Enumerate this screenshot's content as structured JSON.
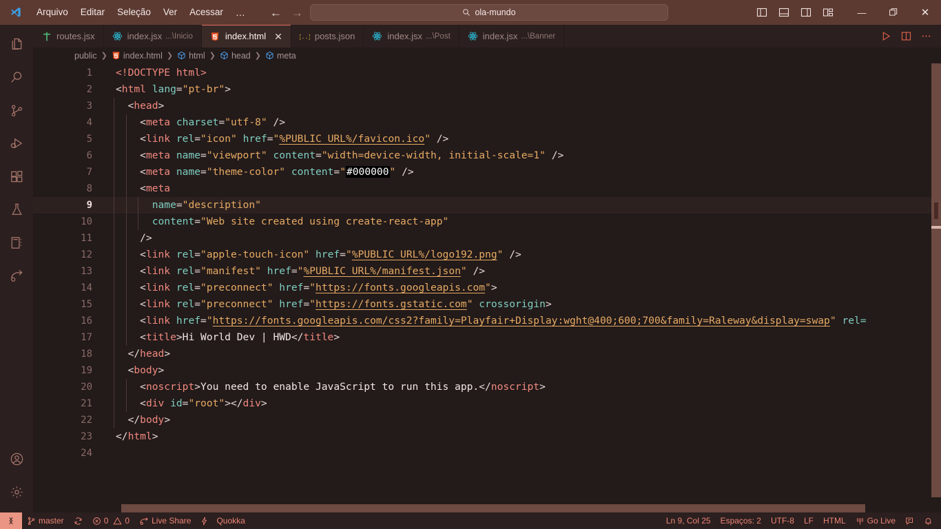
{
  "titlebar": {
    "logo_icon": "vscode-logo-icon",
    "menu": [
      "Arquivo",
      "Editar",
      "Seleção",
      "Ver",
      "Acessar",
      "…"
    ],
    "nav": {
      "back_icon": "arrow-left-icon",
      "forward_icon": "arrow-right-icon"
    },
    "search": {
      "icon": "search-icon",
      "value": "ola-mundo",
      "placeholder": "Pesquisar"
    },
    "layout_icons": [
      "toggle-primary-sidebar-icon",
      "toggle-panel-icon",
      "toggle-secondary-sidebar-icon",
      "customize-layout-icon"
    ],
    "window_controls": {
      "minimize": "—",
      "maximize": "❐",
      "close": "✕"
    }
  },
  "activitybar": {
    "items": [
      {
        "name": "explorer-icon",
        "label": "Explorador"
      },
      {
        "name": "search-icon",
        "label": "Pesquisar"
      },
      {
        "name": "source-control-icon",
        "label": "Controle do Código-Fonte"
      },
      {
        "name": "run-and-debug-icon",
        "label": "Executar e Depurar"
      },
      {
        "name": "extensions-icon",
        "label": "Extensões"
      },
      {
        "name": "testing-flask-icon",
        "label": "Teste"
      },
      {
        "name": "notebook-icon",
        "label": "Bloco de Anotações"
      },
      {
        "name": "live-share-icon",
        "label": "Live Share"
      }
    ],
    "bottom": [
      {
        "name": "account-icon",
        "label": "Contas"
      },
      {
        "name": "settings-gear-icon",
        "label": "Gerenciar"
      }
    ]
  },
  "tabs": [
    {
      "label": "routes.jsx",
      "sub": "",
      "icon": "react-router-icon",
      "active": false,
      "dirty": false
    },
    {
      "label": "index.jsx",
      "sub": "...\\Inicio",
      "icon": "react-icon",
      "active": false,
      "dirty": false
    },
    {
      "label": "index.html",
      "sub": "",
      "icon": "html5-icon",
      "active": true,
      "dirty": false,
      "close": "✕"
    },
    {
      "label": "posts.json",
      "sub": "",
      "icon": "json-icon",
      "active": false,
      "dirty": false
    },
    {
      "label": "index.jsx",
      "sub": "...\\Post",
      "icon": "react-icon",
      "active": false,
      "dirty": false
    },
    {
      "label": "index.jsx",
      "sub": "...\\Banner",
      "icon": "react-icon",
      "active": false,
      "dirty": false
    }
  ],
  "tab_actions": [
    {
      "name": "run-code-icon",
      "label": "Executar Código"
    },
    {
      "name": "split-editor-right-icon",
      "label": "Dividir Editor à Direita"
    },
    {
      "name": "more-actions-icon",
      "label": "Mais Ações..."
    }
  ],
  "breadcrumbs": [
    {
      "label": "public",
      "icon": ""
    },
    {
      "label": "index.html",
      "icon": "html5-icon"
    },
    {
      "label": "html",
      "icon": "symbol-field-icon"
    },
    {
      "label": "head",
      "icon": "symbol-field-icon"
    },
    {
      "label": "meta",
      "icon": "symbol-field-icon"
    }
  ],
  "editor": {
    "language": "HTML",
    "active_line": 9,
    "total_lines": 24,
    "lines": [
      {
        "n": 1,
        "indent": 0,
        "tokens": [
          {
            "c": "t-doctype",
            "t": "<!DOCTYPE html>"
          }
        ]
      },
      {
        "n": 2,
        "indent": 0,
        "tokens": [
          {
            "c": "t-punc",
            "t": "<"
          },
          {
            "c": "t-tag",
            "t": "html"
          },
          {
            "c": "t-punc",
            "t": " "
          },
          {
            "c": "t-attr",
            "t": "lang"
          },
          {
            "c": "t-punc",
            "t": "="
          },
          {
            "c": "t-str",
            "t": "\"pt-br\""
          },
          {
            "c": "t-punc",
            "t": ">"
          }
        ]
      },
      {
        "n": 3,
        "indent": 1,
        "tokens": [
          {
            "c": "t-punc",
            "t": "  <"
          },
          {
            "c": "t-tag",
            "t": "head"
          },
          {
            "c": "t-punc",
            "t": ">"
          }
        ]
      },
      {
        "n": 4,
        "indent": 2,
        "tokens": [
          {
            "c": "t-punc",
            "t": "    <"
          },
          {
            "c": "t-tag",
            "t": "meta"
          },
          {
            "c": "t-punc",
            "t": " "
          },
          {
            "c": "t-attr",
            "t": "charset"
          },
          {
            "c": "t-punc",
            "t": "="
          },
          {
            "c": "t-str",
            "t": "\"utf-8\""
          },
          {
            "c": "t-punc",
            "t": " />"
          }
        ]
      },
      {
        "n": 5,
        "indent": 2,
        "tokens": [
          {
            "c": "t-punc",
            "t": "    <"
          },
          {
            "c": "t-tag",
            "t": "link"
          },
          {
            "c": "t-punc",
            "t": " "
          },
          {
            "c": "t-attr",
            "t": "rel"
          },
          {
            "c": "t-punc",
            "t": "="
          },
          {
            "c": "t-str",
            "t": "\"icon\""
          },
          {
            "c": "t-punc",
            "t": " "
          },
          {
            "c": "t-attr",
            "t": "href"
          },
          {
            "c": "t-punc",
            "t": "="
          },
          {
            "c": "t-str",
            "t": "\""
          },
          {
            "c": "t-link",
            "t": "%PUBLIC_URL%/favicon.ico"
          },
          {
            "c": "t-str",
            "t": "\""
          },
          {
            "c": "t-punc",
            "t": " />"
          }
        ]
      },
      {
        "n": 6,
        "indent": 2,
        "tokens": [
          {
            "c": "t-punc",
            "t": "    <"
          },
          {
            "c": "t-tag",
            "t": "meta"
          },
          {
            "c": "t-punc",
            "t": " "
          },
          {
            "c": "t-attr",
            "t": "name"
          },
          {
            "c": "t-punc",
            "t": "="
          },
          {
            "c": "t-str",
            "t": "\"viewport\""
          },
          {
            "c": "t-punc",
            "t": " "
          },
          {
            "c": "t-attr",
            "t": "content"
          },
          {
            "c": "t-punc",
            "t": "="
          },
          {
            "c": "t-str",
            "t": "\"width=device-width, initial-scale=1\""
          },
          {
            "c": "t-punc",
            "t": " />"
          }
        ]
      },
      {
        "n": 7,
        "indent": 2,
        "tokens": [
          {
            "c": "t-punc",
            "t": "    <"
          },
          {
            "c": "t-tag",
            "t": "meta"
          },
          {
            "c": "t-punc",
            "t": " "
          },
          {
            "c": "t-attr",
            "t": "name"
          },
          {
            "c": "t-punc",
            "t": "="
          },
          {
            "c": "t-str",
            "t": "\"theme-color\""
          },
          {
            "c": "t-punc",
            "t": " "
          },
          {
            "c": "t-attr",
            "t": "content"
          },
          {
            "c": "t-punc",
            "t": "="
          },
          {
            "c": "t-str",
            "t": "\""
          },
          {
            "c": "swatch",
            "t": "#000000"
          },
          {
            "c": "t-str",
            "t": "\""
          },
          {
            "c": "t-punc",
            "t": " />"
          }
        ]
      },
      {
        "n": 8,
        "indent": 2,
        "tokens": [
          {
            "c": "t-punc",
            "t": "    <"
          },
          {
            "c": "t-tag",
            "t": "meta"
          }
        ]
      },
      {
        "n": 9,
        "indent": 3,
        "tokens": [
          {
            "c": "t-punc",
            "t": "      "
          },
          {
            "c": "t-attr",
            "t": "name"
          },
          {
            "c": "t-punc",
            "t": "="
          },
          {
            "c": "t-str",
            "t": "\"description\""
          }
        ]
      },
      {
        "n": 10,
        "indent": 3,
        "tokens": [
          {
            "c": "t-punc",
            "t": "      "
          },
          {
            "c": "t-attr",
            "t": "content"
          },
          {
            "c": "t-punc",
            "t": "="
          },
          {
            "c": "t-str",
            "t": "\"Web site created using create-react-app\""
          }
        ]
      },
      {
        "n": 11,
        "indent": 2,
        "tokens": [
          {
            "c": "t-punc",
            "t": "    />"
          }
        ]
      },
      {
        "n": 12,
        "indent": 2,
        "tokens": [
          {
            "c": "t-punc",
            "t": "    <"
          },
          {
            "c": "t-tag",
            "t": "link"
          },
          {
            "c": "t-punc",
            "t": " "
          },
          {
            "c": "t-attr",
            "t": "rel"
          },
          {
            "c": "t-punc",
            "t": "="
          },
          {
            "c": "t-str",
            "t": "\"apple-touch-icon\""
          },
          {
            "c": "t-punc",
            "t": " "
          },
          {
            "c": "t-attr",
            "t": "href"
          },
          {
            "c": "t-punc",
            "t": "="
          },
          {
            "c": "t-str",
            "t": "\""
          },
          {
            "c": "t-link",
            "t": "%PUBLIC_URL%/logo192.png"
          },
          {
            "c": "t-str",
            "t": "\""
          },
          {
            "c": "t-punc",
            "t": " />"
          }
        ]
      },
      {
        "n": 13,
        "indent": 2,
        "tokens": [
          {
            "c": "t-punc",
            "t": "    <"
          },
          {
            "c": "t-tag",
            "t": "link"
          },
          {
            "c": "t-punc",
            "t": " "
          },
          {
            "c": "t-attr",
            "t": "rel"
          },
          {
            "c": "t-punc",
            "t": "="
          },
          {
            "c": "t-str",
            "t": "\"manifest\""
          },
          {
            "c": "t-punc",
            "t": " "
          },
          {
            "c": "t-attr",
            "t": "href"
          },
          {
            "c": "t-punc",
            "t": "="
          },
          {
            "c": "t-str",
            "t": "\""
          },
          {
            "c": "t-link",
            "t": "%PUBLIC_URL%/manifest.json"
          },
          {
            "c": "t-str",
            "t": "\""
          },
          {
            "c": "t-punc",
            "t": " />"
          }
        ]
      },
      {
        "n": 14,
        "indent": 2,
        "tokens": [
          {
            "c": "t-punc",
            "t": "    <"
          },
          {
            "c": "t-tag",
            "t": "link"
          },
          {
            "c": "t-punc",
            "t": " "
          },
          {
            "c": "t-attr",
            "t": "rel"
          },
          {
            "c": "t-punc",
            "t": "="
          },
          {
            "c": "t-str",
            "t": "\"preconnect\""
          },
          {
            "c": "t-punc",
            "t": " "
          },
          {
            "c": "t-attr",
            "t": "href"
          },
          {
            "c": "t-punc",
            "t": "="
          },
          {
            "c": "t-str",
            "t": "\""
          },
          {
            "c": "t-link",
            "t": "https://fonts.googleapis.com"
          },
          {
            "c": "t-str",
            "t": "\""
          },
          {
            "c": "t-punc",
            "t": ">"
          }
        ]
      },
      {
        "n": 15,
        "indent": 2,
        "tokens": [
          {
            "c": "t-punc",
            "t": "    <"
          },
          {
            "c": "t-tag",
            "t": "link"
          },
          {
            "c": "t-punc",
            "t": " "
          },
          {
            "c": "t-attr",
            "t": "rel"
          },
          {
            "c": "t-punc",
            "t": "="
          },
          {
            "c": "t-str",
            "t": "\"preconnect\""
          },
          {
            "c": "t-punc",
            "t": " "
          },
          {
            "c": "t-attr",
            "t": "href"
          },
          {
            "c": "t-punc",
            "t": "="
          },
          {
            "c": "t-str",
            "t": "\""
          },
          {
            "c": "t-link",
            "t": "https://fonts.gstatic.com"
          },
          {
            "c": "t-str",
            "t": "\""
          },
          {
            "c": "t-punc",
            "t": " "
          },
          {
            "c": "t-attr",
            "t": "crossorigin"
          },
          {
            "c": "t-punc",
            "t": ">"
          }
        ]
      },
      {
        "n": 16,
        "indent": 2,
        "tokens": [
          {
            "c": "t-punc",
            "t": "    <"
          },
          {
            "c": "t-tag",
            "t": "link"
          },
          {
            "c": "t-punc",
            "t": " "
          },
          {
            "c": "t-attr",
            "t": "href"
          },
          {
            "c": "t-punc",
            "t": "="
          },
          {
            "c": "t-str",
            "t": "\""
          },
          {
            "c": "t-link",
            "t": "https://fonts.googleapis.com/css2?family=Playfair+Display:wght@400;600;700&family=Raleway&display=swap"
          },
          {
            "c": "t-str",
            "t": "\""
          },
          {
            "c": "t-punc",
            "t": " "
          },
          {
            "c": "t-attr",
            "t": "rel="
          }
        ]
      },
      {
        "n": 17,
        "indent": 2,
        "tokens": [
          {
            "c": "t-punc",
            "t": "    <"
          },
          {
            "c": "t-tag",
            "t": "title"
          },
          {
            "c": "t-punc",
            "t": ">"
          },
          {
            "c": "t-txt",
            "t": "Hi World Dev | HWD"
          },
          {
            "c": "t-punc",
            "t": "</"
          },
          {
            "c": "t-tag",
            "t": "title"
          },
          {
            "c": "t-punc",
            "t": ">"
          }
        ]
      },
      {
        "n": 18,
        "indent": 1,
        "tokens": [
          {
            "c": "t-punc",
            "t": "  </"
          },
          {
            "c": "t-tag",
            "t": "head"
          },
          {
            "c": "t-punc",
            "t": ">"
          }
        ]
      },
      {
        "n": 19,
        "indent": 1,
        "tokens": [
          {
            "c": "t-punc",
            "t": "  <"
          },
          {
            "c": "t-tag",
            "t": "body"
          },
          {
            "c": "t-punc",
            "t": ">"
          }
        ]
      },
      {
        "n": 20,
        "indent": 2,
        "tokens": [
          {
            "c": "t-punc",
            "t": "    <"
          },
          {
            "c": "t-tag",
            "t": "noscript"
          },
          {
            "c": "t-punc",
            "t": ">"
          },
          {
            "c": "t-txt",
            "t": "You need to enable JavaScript to run this app."
          },
          {
            "c": "t-punc",
            "t": "</"
          },
          {
            "c": "t-tag",
            "t": "noscript"
          },
          {
            "c": "t-punc",
            "t": ">"
          }
        ]
      },
      {
        "n": 21,
        "indent": 2,
        "tokens": [
          {
            "c": "t-punc",
            "t": "    <"
          },
          {
            "c": "t-tag",
            "t": "div"
          },
          {
            "c": "t-punc",
            "t": " "
          },
          {
            "c": "t-attr",
            "t": "id"
          },
          {
            "c": "t-punc",
            "t": "="
          },
          {
            "c": "t-str",
            "t": "\"root\""
          },
          {
            "c": "t-punc",
            "t": "></"
          },
          {
            "c": "t-tag",
            "t": "div"
          },
          {
            "c": "t-punc",
            "t": ">"
          }
        ]
      },
      {
        "n": 22,
        "indent": 1,
        "tokens": [
          {
            "c": "t-punc",
            "t": "  </"
          },
          {
            "c": "t-tag",
            "t": "body"
          },
          {
            "c": "t-punc",
            "t": ">"
          }
        ]
      },
      {
        "n": 23,
        "indent": 0,
        "tokens": [
          {
            "c": "t-punc",
            "t": "</"
          },
          {
            "c": "t-tag",
            "t": "html"
          },
          {
            "c": "t-punc",
            "t": ">"
          }
        ]
      },
      {
        "n": 24,
        "indent": 0,
        "tokens": []
      }
    ]
  },
  "statusbar": {
    "remote_icon": "remote-window-icon",
    "left": [
      {
        "icon": "source-control-branch-icon",
        "label": "master"
      },
      {
        "icon": "sync-icon",
        "label": ""
      },
      {
        "icon": "error-icon",
        "label": "0",
        "icon2": "warning-icon",
        "label2": "0"
      },
      {
        "icon": "live-share-icon",
        "label": "Live Share"
      },
      {
        "icon": "quokka-icon",
        "label": "Quokka"
      }
    ],
    "right": [
      {
        "icon": "",
        "label": "Ln 9, Col 25"
      },
      {
        "icon": "",
        "label": "Espaços: 2"
      },
      {
        "icon": "",
        "label": "UTF-8"
      },
      {
        "icon": "",
        "label": "LF"
      },
      {
        "icon": "",
        "label": "HTML"
      },
      {
        "icon": "broadcast-icon",
        "label": "Go Live"
      },
      {
        "icon": "feedback-icon",
        "label": ""
      },
      {
        "icon": "bell-icon",
        "label": ""
      }
    ]
  },
  "colors": {
    "titlebar_bg": "#5c3a32",
    "activitybar_bg": "#2b1f1f",
    "editor_bg": "#231a1a",
    "tab_active_bg": "#3a2a27",
    "accent": "#e06c5c",
    "status_text": "#ee8476",
    "remote_bg": "#eb9584"
  }
}
